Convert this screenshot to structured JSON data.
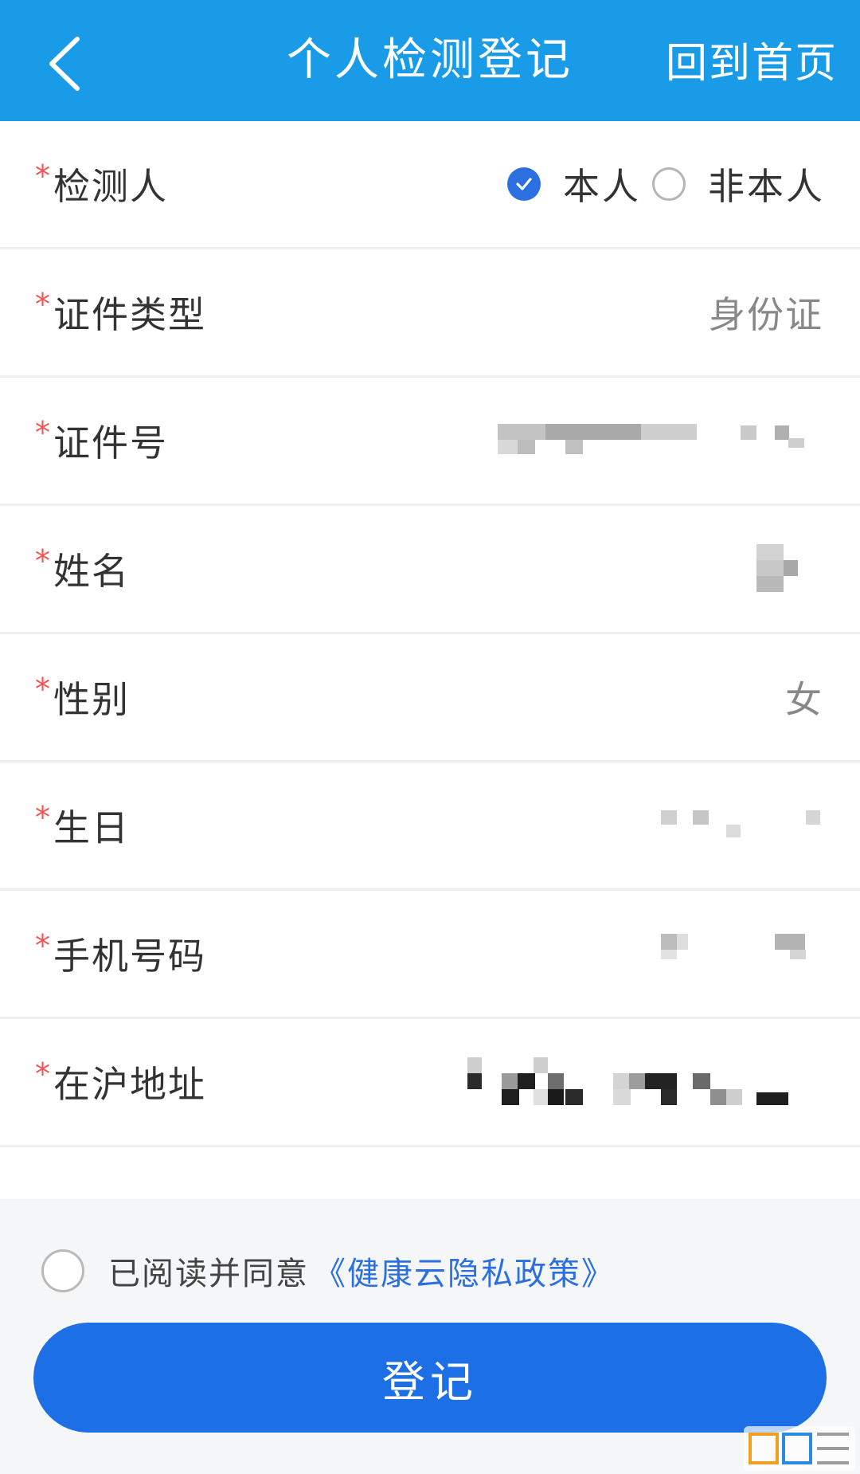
{
  "header": {
    "title": "个人检测登记",
    "home_label": "回到首页",
    "background": "#1a9be8"
  },
  "form": {
    "tester": {
      "label": "检测人",
      "options": [
        "本人",
        "非本人"
      ],
      "selected": "本人"
    },
    "id_type": {
      "label": "证件类型",
      "value": "身份证"
    },
    "id_number": {
      "label": "证件号"
    },
    "name": {
      "label": "姓名"
    },
    "gender": {
      "label": "性别",
      "value": "女"
    },
    "birthday": {
      "label": "生日"
    },
    "phone": {
      "label": "手机号码"
    },
    "address": {
      "label": "在沪地址"
    },
    "required_mark": "*"
  },
  "agreement": {
    "text": "已阅读并同意",
    "link": "《健康云隐私政策》",
    "checked": false
  },
  "submit": {
    "label": "登记",
    "color": "#1d6fe6"
  },
  "watermark": {
    "icon": "962-net-logo"
  }
}
